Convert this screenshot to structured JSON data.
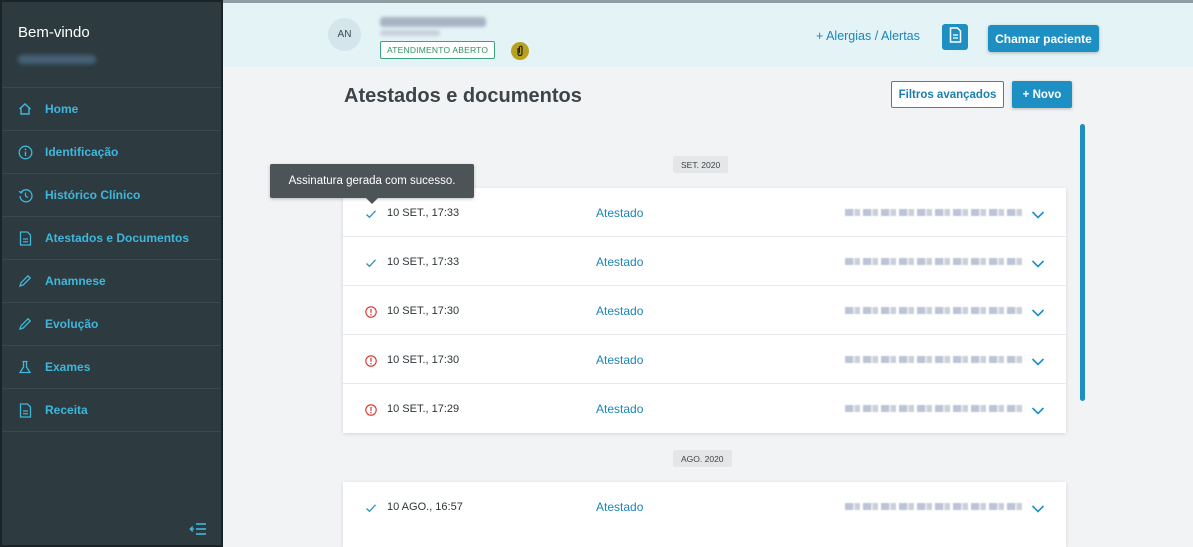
{
  "sidebar": {
    "welcome": "Bem-vindo",
    "items": [
      {
        "label": "Home",
        "icon": "home-icon"
      },
      {
        "label": "Identificação",
        "icon": "info-icon"
      },
      {
        "label": "Histórico Clínico",
        "icon": "history-icon"
      },
      {
        "label": "Atestados e Documentos",
        "icon": "document-icon"
      },
      {
        "label": "Anamnese",
        "icon": "pencil-icon"
      },
      {
        "label": "Evolução",
        "icon": "pencil-icon"
      },
      {
        "label": "Exames",
        "icon": "flask-icon"
      },
      {
        "label": "Receita",
        "icon": "document-icon"
      }
    ],
    "collapse_icon": "collapse-menu-icon"
  },
  "header": {
    "avatar_initials": "AN",
    "status_badge": "ATENDIMENTO ABERTO",
    "alerts_link": "+ Alergias / Alertas",
    "call_button": "Chamar paciente"
  },
  "main": {
    "title": "Atestados e documentos",
    "filters_button": "Filtros avançados",
    "new_button": "+ Novo",
    "tooltip": "Assinatura gerada com sucesso.",
    "groups": [
      {
        "month": "SET. 2020",
        "rows": [
          {
            "status": "success",
            "datetime": "10 SET., 17:33",
            "type": "Atestado"
          },
          {
            "status": "success",
            "datetime": "10 SET., 17:33",
            "type": "Atestado"
          },
          {
            "status": "error",
            "datetime": "10 SET., 17:30",
            "type": "Atestado"
          },
          {
            "status": "error",
            "datetime": "10 SET., 17:30",
            "type": "Atestado"
          },
          {
            "status": "error",
            "datetime": "10 SET., 17:29",
            "type": "Atestado"
          }
        ]
      },
      {
        "month": "AGO. 2020",
        "rows": [
          {
            "status": "success",
            "datetime": "10 AGO., 16:57",
            "type": "Atestado"
          }
        ]
      }
    ]
  },
  "colors": {
    "sidebar_bg": "#2d3a3f",
    "accent": "#1d8fc3",
    "link": "#1b86b8",
    "success": "#2f8fb3",
    "error": "#d9312b",
    "header_bg": "#e4f3f6"
  }
}
